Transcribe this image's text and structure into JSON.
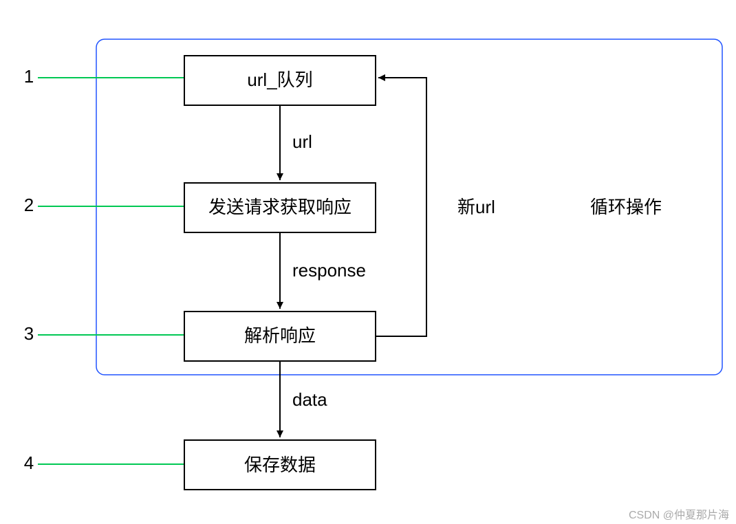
{
  "numbers": {
    "n1": "1",
    "n2": "2",
    "n3": "3",
    "n4": "4"
  },
  "boxes": {
    "b1": "url_队列",
    "b2": "发送请求获取响应",
    "b3": "解析响应",
    "b4": "保存数据"
  },
  "edges": {
    "e1": "url",
    "e2": "response",
    "e3": "data",
    "e4": "新url"
  },
  "loop_label": "循环操作",
  "watermark": "CSDN @仲夏那片海"
}
